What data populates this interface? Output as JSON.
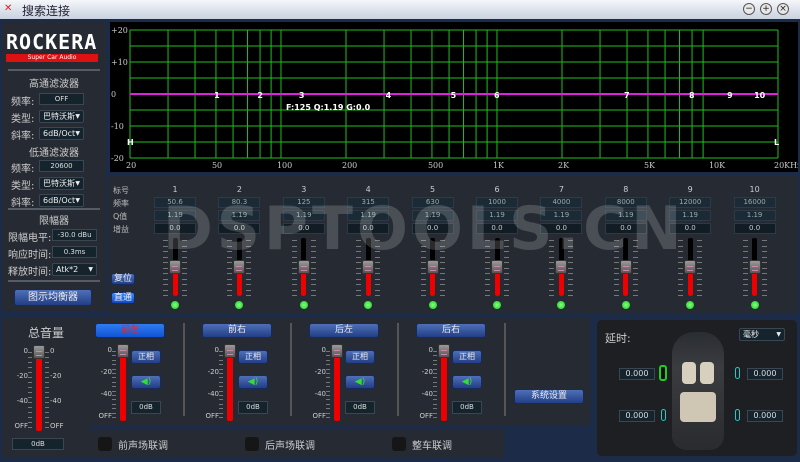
{
  "window": {
    "title": "搜索连接",
    "controls": [
      "minimize",
      "maximize",
      "close"
    ]
  },
  "logo": {
    "brand": "ROCKERA",
    "tagline": "Super Car Audio"
  },
  "highpass": {
    "title": "高通滤波器",
    "freq_label": "频率:",
    "freq": "OFF",
    "type_label": "类型:",
    "type": "巴特沃斯",
    "slope_label": "斜率:",
    "slope": "6dB/Oct"
  },
  "lowpass": {
    "title": "低通滤波器",
    "freq_label": "频率:",
    "freq": "20600",
    "type_label": "类型:",
    "type": "巴特沃斯",
    "slope_label": "斜率:",
    "slope": "6dB/Oct"
  },
  "limiter": {
    "title": "限幅器",
    "level_label": "限幅电平:",
    "level": "-30.0 dBu",
    "response_label": "响应时间:",
    "response": "0.3ms",
    "release_label": "释放时间:",
    "release": "Atk*2"
  },
  "geq_button": "图示均衡器",
  "graph": {
    "y_ticks": [
      "+20",
      "+10",
      "0",
      "-10",
      "-20"
    ],
    "x_ticks": [
      "20",
      "50",
      "100",
      "200",
      "500",
      "1K",
      "2K",
      "5K",
      "10K",
      "20KHz"
    ],
    "ylim": [
      -20,
      20
    ],
    "xlim": [
      20,
      20000
    ],
    "hp_marker": "H",
    "lp_marker": "L",
    "readout": "F:125 Q:1.19 G:0.0",
    "curve_color": "#e020e0",
    "grid_color": "#1fbf1f"
  },
  "eq": {
    "row_labels": [
      "标号",
      "频率",
      "Q值",
      "增益"
    ],
    "reset": "复位",
    "bypass": "直通",
    "bands": [
      {
        "id": "1",
        "freq": "50.6",
        "q": "1.19",
        "gain": "0.0",
        "f": 50.6
      },
      {
        "id": "2",
        "freq": "80.3",
        "q": "1.19",
        "gain": "0.0",
        "f": 80.3
      },
      {
        "id": "3",
        "freq": "125",
        "q": "1.19",
        "gain": "0.0",
        "f": 125
      },
      {
        "id": "4",
        "freq": "315",
        "q": "1.19",
        "gain": "0.0",
        "f": 315
      },
      {
        "id": "5",
        "freq": "630",
        "q": "1.19",
        "gain": "0.0",
        "f": 630
      },
      {
        "id": "6",
        "freq": "1000",
        "q": "1.19",
        "gain": "0.0",
        "f": 1000
      },
      {
        "id": "7",
        "freq": "4000",
        "q": "1.19",
        "gain": "0.0",
        "f": 4000
      },
      {
        "id": "8",
        "freq": "8000",
        "q": "1.19",
        "gain": "0.0",
        "f": 8000
      },
      {
        "id": "9",
        "freq": "12000",
        "q": "1.19",
        "gain": "0.0",
        "f": 12000
      },
      {
        "id": "10",
        "freq": "16000",
        "q": "1.19",
        "gain": "0.0",
        "f": 16000
      }
    ]
  },
  "watermark": "DSPTOOLS.CN",
  "master": {
    "title": "总音量",
    "scale": [
      "0",
      "-20",
      "-40",
      "OFF"
    ],
    "value": "0dB",
    "level_db": 0
  },
  "channels": [
    {
      "name": "前左",
      "phase": "正相",
      "value": "0dB",
      "scale": [
        "0",
        "-20",
        "-40",
        "OFF"
      ],
      "active": true
    },
    {
      "name": "前右",
      "phase": "正相",
      "value": "0dB",
      "scale": [
        "0",
        "-20",
        "-40",
        "OFF"
      ],
      "active": false
    },
    {
      "name": "后左",
      "phase": "正相",
      "value": "0dB",
      "scale": [
        "0",
        "-20",
        "-40",
        "OFF"
      ],
      "active": false
    },
    {
      "name": "后右",
      "phase": "正相",
      "value": "0dB",
      "scale": [
        "0",
        "-20",
        "-40",
        "OFF"
      ],
      "active": false
    }
  ],
  "system_settings": "系统设置",
  "links": [
    "前声场联调",
    "后声场联调",
    "整车联调"
  ],
  "delay": {
    "title": "延时:",
    "unit": "毫秒",
    "fl": "0.000",
    "fr": "0.000",
    "rl": "0.000",
    "rr": "0.000"
  }
}
